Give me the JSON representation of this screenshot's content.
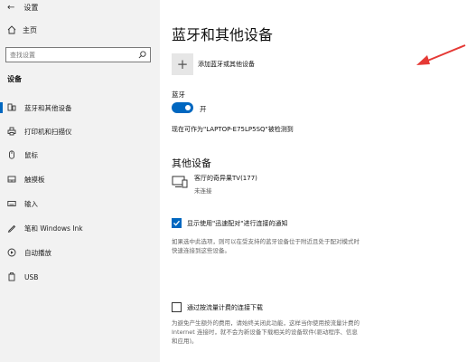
{
  "app": {
    "title": "设置"
  },
  "sidebar": {
    "home_label": "主页",
    "search_placeholder": "查找设置",
    "section": "设备",
    "items": [
      {
        "label": "蓝牙和其他设备",
        "icon": "bluetooth-devices-icon"
      },
      {
        "label": "打印机和扫描仪",
        "icon": "printer-icon"
      },
      {
        "label": "鼠标",
        "icon": "mouse-icon"
      },
      {
        "label": "触摸板",
        "icon": "touchpad-icon"
      },
      {
        "label": "输入",
        "icon": "keyboard-icon"
      },
      {
        "label": "笔和 Windows Ink",
        "icon": "pen-icon"
      },
      {
        "label": "自动播放",
        "icon": "autoplay-icon"
      },
      {
        "label": "USB",
        "icon": "usb-icon"
      }
    ]
  },
  "main": {
    "title": "蓝牙和其他设备",
    "add_device_label": "添加蓝牙或其他设备",
    "bluetooth_label": "蓝牙",
    "bluetooth_state": "开",
    "discoverable_text": "现在可作为\"LAPTOP-E75LP5SQ\"被检测到",
    "other_devices_title": "其他设备",
    "device": {
      "name": "客厅的奇异果TV(177)",
      "status": "未连接"
    },
    "swift_pair": {
      "label": "显示使用\"迅速配对\"进行连接的通知",
      "description_line1": "如果选中此选项，则可以在受支持的蓝牙设备位于附近且处于配对模式时",
      "description_line2": "快速连接到这些设备。"
    },
    "metered": {
      "label": "通过按流量计费的连接下载",
      "description_line1": "为避免产生额外的费用，请始终关闭此功能，这样当你使用按流量计费的",
      "description_line2": "Internet 连接时，就不会为新设备下载相关的设备软件(驱动程序、信息",
      "description_line3": "和应用)。"
    }
  },
  "colors": {
    "accent": "#0067c0",
    "arrow": "#e53935",
    "sidebar_bg": "#f2f2f2"
  }
}
